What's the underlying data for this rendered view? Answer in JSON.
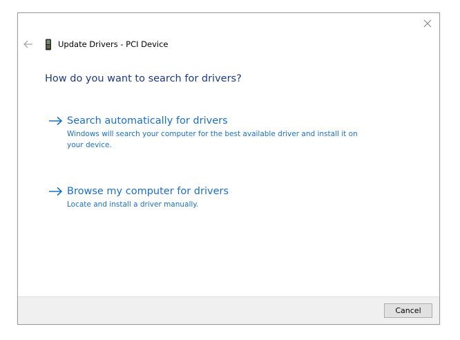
{
  "window": {
    "title": "Update Drivers - PCI Device",
    "close_icon": "close-icon",
    "back_icon": "back-arrow-icon",
    "device_icon": "pci-device-icon"
  },
  "main": {
    "heading": "How do you want to search for drivers?",
    "options": [
      {
        "title": "Search automatically for drivers",
        "description": "Windows will search your computer for the best available driver and install it on your device.",
        "icon": "arrow-right-icon"
      },
      {
        "title": "Browse my computer for drivers",
        "description": "Locate and install a driver manually.",
        "icon": "arrow-right-icon"
      }
    ]
  },
  "footer": {
    "cancel_label": "Cancel"
  },
  "colors": {
    "heading": "#1c3a82",
    "link": "#1a6fc4",
    "footer_bg": "#f0f0f0"
  }
}
